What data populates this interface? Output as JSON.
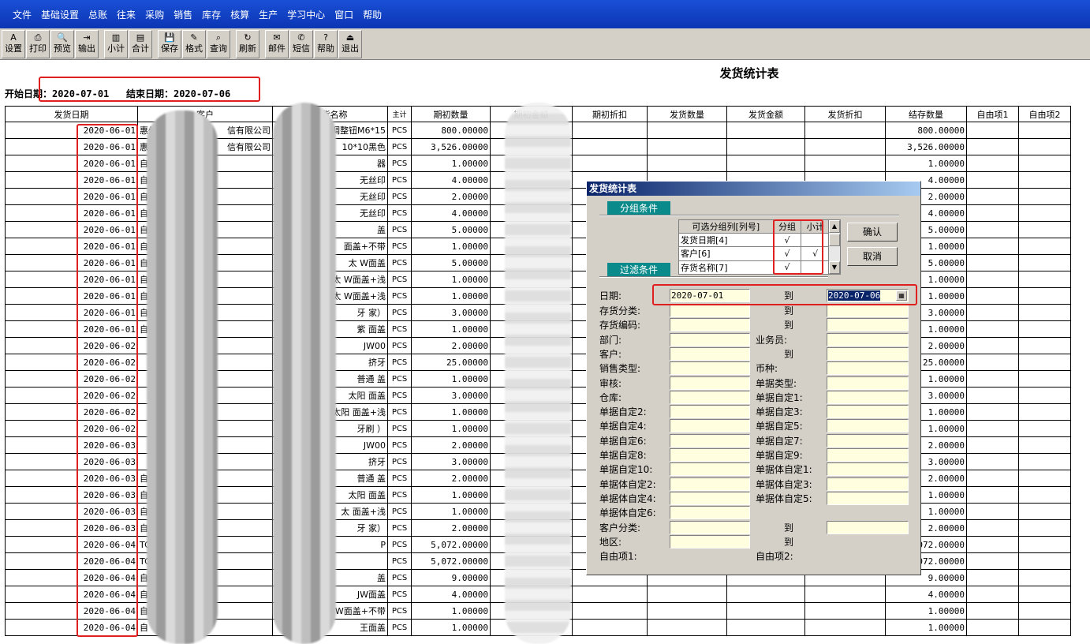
{
  "menu": [
    "文件",
    "基础设置",
    "总账",
    "往来",
    "采购",
    "销售",
    "库存",
    "核算",
    "生产",
    "学习中心",
    "窗口",
    "帮助"
  ],
  "toolbar": [
    {
      "label": "设置",
      "icon": "settings-icon",
      "glyph": "A"
    },
    {
      "label": "打印",
      "icon": "print-icon",
      "glyph": "⎙"
    },
    {
      "label": "预览",
      "icon": "preview-icon",
      "glyph": "🔍"
    },
    {
      "label": "输出",
      "icon": "export-icon",
      "glyph": "⇥"
    },
    {
      "label": "小计",
      "icon": "subtotal-icon",
      "glyph": "▥"
    },
    {
      "label": "合计",
      "icon": "total-icon",
      "glyph": "▤"
    },
    {
      "label": "保存",
      "icon": "save-icon",
      "glyph": "💾"
    },
    {
      "label": "格式",
      "icon": "format-icon",
      "glyph": "✎"
    },
    {
      "label": "查询",
      "icon": "query-icon",
      "glyph": "⌕"
    },
    {
      "label": "刷新",
      "icon": "refresh-icon",
      "glyph": "↻"
    },
    {
      "label": "邮件",
      "icon": "mail-icon",
      "glyph": "✉"
    },
    {
      "label": "短信",
      "icon": "sms-icon",
      "glyph": "✆"
    },
    {
      "label": "帮助",
      "icon": "help-icon",
      "glyph": "?"
    },
    {
      "label": "退出",
      "icon": "exit-icon",
      "glyph": "⏏"
    }
  ],
  "report": {
    "title": "发货统计表",
    "start_label": "开始日期：",
    "start_date": "2020-07-01",
    "end_label": "结束日期：",
    "end_date": "2020-07-06"
  },
  "columns": [
    "发货日期",
    "客户",
    "存货名称",
    "主计",
    "期初数量",
    "期初金额",
    "期初折扣",
    "发货数量",
    "发货金额",
    "发货折扣",
    "结存数量",
    "自由项1",
    "自由项2"
  ],
  "rows": [
    {
      "date": "2020-06-01",
      "customer": "惠州",
      "customer_tail": "信有限公司",
      "item": "调整钮M6*15",
      "unit": "PCS",
      "opening": "800.00000",
      "balance": "800.00000"
    },
    {
      "date": "2020-06-01",
      "customer": "惠州",
      "customer_tail": "信有限公司",
      "item": "10*10黑色",
      "unit": "PCS",
      "opening": "3,526.00000",
      "balance": "3,526.00000"
    },
    {
      "date": "2020-06-01",
      "customer": "自主",
      "customer_tail": "",
      "item": "器",
      "unit": "PCS",
      "opening": "1.00000",
      "balance": "1.00000"
    },
    {
      "date": "2020-06-01",
      "customer": "自主",
      "customer_tail": "",
      "item": "无丝印",
      "unit": "PCS",
      "opening": "4.00000",
      "balance": "4.00000"
    },
    {
      "date": "2020-06-01",
      "customer": "自主",
      "customer_tail": "",
      "item": "无丝印",
      "unit": "PCS",
      "opening": "2.00000",
      "balance": "2.00000"
    },
    {
      "date": "2020-06-01",
      "customer": "自主",
      "customer_tail": "",
      "item": "无丝印",
      "unit": "PCS",
      "opening": "4.00000",
      "balance": "4.00000"
    },
    {
      "date": "2020-06-01",
      "customer": "自主",
      "customer_tail": "",
      "item": "盖",
      "unit": "PCS",
      "opening": "5.00000",
      "balance": "5.00000"
    },
    {
      "date": "2020-06-01",
      "customer": "自",
      "customer_tail": "",
      "item": "面盖+不带",
      "unit": "PCS",
      "opening": "1.00000",
      "balance": "1.00000"
    },
    {
      "date": "2020-06-01",
      "customer": "自",
      "customer_tail": "",
      "item": "太 W面盖",
      "unit": "PCS",
      "opening": "5.00000",
      "balance": "5.00000"
    },
    {
      "date": "2020-06-01",
      "customer": "自",
      "customer_tail": "",
      "item": "太 W面盖+浅",
      "unit": "PCS",
      "opening": "1.00000",
      "balance": "1.00000"
    },
    {
      "date": "2020-06-01",
      "customer": "自",
      "customer_tail": "",
      "item": "太 W面盖+浅",
      "unit": "PCS",
      "opening": "1.00000",
      "balance": "1.00000"
    },
    {
      "date": "2020-06-01",
      "customer": "自",
      "customer_tail": "",
      "item": "牙 家）",
      "unit": "PCS",
      "opening": "3.00000",
      "balance": "3.00000"
    },
    {
      "date": "2020-06-01",
      "customer": "自",
      "customer_tail": "",
      "item": "紫 面盖",
      "unit": "PCS",
      "opening": "1.00000",
      "balance": "1.00000"
    },
    {
      "date": "2020-06-02",
      "customer": "",
      "customer_tail": "",
      "item": "JW00",
      "unit": "PCS",
      "opening": "2.00000",
      "balance": "2.00000"
    },
    {
      "date": "2020-06-02",
      "customer": "",
      "customer_tail": "",
      "item": "挤牙",
      "unit": "PCS",
      "opening": "25.00000",
      "balance": "25.00000"
    },
    {
      "date": "2020-06-02",
      "customer": "",
      "customer_tail": "",
      "item": "普通 盖",
      "unit": "PCS",
      "opening": "1.00000",
      "balance": "1.00000"
    },
    {
      "date": "2020-06-02",
      "customer": "",
      "customer_tail": "",
      "item": "太阳 面盖",
      "unit": "PCS",
      "opening": "3.00000",
      "balance": "3.00000"
    },
    {
      "date": "2020-06-02",
      "customer": "",
      "customer_tail": "",
      "item": "太阳 面盖+浅",
      "unit": "PCS",
      "opening": "1.00000",
      "balance": "1.00000"
    },
    {
      "date": "2020-06-02",
      "customer": "",
      "customer_tail": "",
      "item": "牙刷 ）",
      "unit": "PCS",
      "opening": "1.00000",
      "balance": "1.00000"
    },
    {
      "date": "2020-06-03",
      "customer": "",
      "customer_tail": "",
      "item": "JW00",
      "unit": "PCS",
      "opening": "2.00000",
      "balance": "2.00000"
    },
    {
      "date": "2020-06-03",
      "customer": "",
      "customer_tail": "",
      "item": "挤牙",
      "unit": "PCS",
      "opening": "3.00000",
      "balance": "3.00000"
    },
    {
      "date": "2020-06-03",
      "customer": "自",
      "customer_tail": "",
      "item": "普通 盖",
      "unit": "PCS",
      "opening": "2.00000",
      "balance": "2.00000"
    },
    {
      "date": "2020-06-03",
      "customer": "自",
      "customer_tail": "",
      "item": "太阳 面盖",
      "unit": "PCS",
      "opening": "1.00000",
      "balance": "1.00000"
    },
    {
      "date": "2020-06-03",
      "customer": "自",
      "customer_tail": "",
      "item": "太 面盖+浅",
      "unit": "PCS",
      "opening": "1.00000",
      "balance": "1.00000"
    },
    {
      "date": "2020-06-03",
      "customer": "自",
      "customer_tail": "",
      "item": "牙 家）",
      "unit": "PCS",
      "opening": "2.00000",
      "balance": "2.00000"
    },
    {
      "date": "2020-06-04",
      "customer": "TC",
      "customer_tail": "",
      "item": "P",
      "unit": "PCS",
      "opening": "5,072.00000",
      "balance": "072.00000"
    },
    {
      "date": "2020-06-04",
      "customer": "TC",
      "customer_tail": "",
      "item": "",
      "unit": "PCS",
      "opening": "5,072.00000",
      "balance": "072.00000"
    },
    {
      "date": "2020-06-04",
      "customer": "自",
      "customer_tail": "",
      "item": "盖",
      "unit": "PCS",
      "opening": "9.00000",
      "balance": "9.00000"
    },
    {
      "date": "2020-06-04",
      "customer": "自",
      "customer_tail": "",
      "item": "JW面盖",
      "unit": "PCS",
      "opening": "4.00000",
      "balance": "4.00000"
    },
    {
      "date": "2020-06-04",
      "customer": "自",
      "customer_tail": "",
      "item": "W面盖+不带",
      "unit": "PCS",
      "opening": "1.00000",
      "balance": "1.00000"
    },
    {
      "date": "2020-06-04",
      "customer": "自",
      "customer_tail": "",
      "item": "王面盖",
      "unit": "PCS",
      "opening": "1.00000",
      "balance": "1.00000"
    }
  ],
  "dialog": {
    "title": "发货统计表",
    "group_section": "分组条件",
    "filter_section": "过滤条件",
    "grid_headers": [
      "可选分组列[列号]",
      "分组",
      "小计"
    ],
    "grid_rows": [
      {
        "name": "发货日期[4]",
        "group": "√",
        "subtotal": ""
      },
      {
        "name": "客户[6]",
        "group": "√",
        "subtotal": "√"
      },
      {
        "name": "存货名称[7]",
        "group": "√",
        "subtotal": ""
      }
    ],
    "confirm": "确认",
    "cancel": "取消",
    "to": "到",
    "date_label": "日期:",
    "date_from": "2020-07-01",
    "date_to": "2020-07-06",
    "left_labels": [
      "存货分类:",
      "存货编码:",
      "部门:",
      "客户:",
      "销售类型:",
      "审核:",
      "仓库:",
      "单据自定2:",
      "单据自定4:",
      "单据自定6:",
      "单据自定8:",
      "单据自定10:",
      "单据体自定2:",
      "单据体自定4:",
      "单据体自定6:",
      "客户分类:",
      "地区:",
      "自由项1:"
    ],
    "right_labels": [
      "到",
      "到",
      "业务员:",
      "到",
      "币种:",
      "单据类型:",
      "单据自定1:",
      "单据自定3:",
      "单据自定5:",
      "单据自定7:",
      "单据自定9:",
      "单据体自定1:",
      "单据体自定3:",
      "单据体自定5:",
      "",
      "到",
      "到",
      "自由项2:"
    ]
  }
}
